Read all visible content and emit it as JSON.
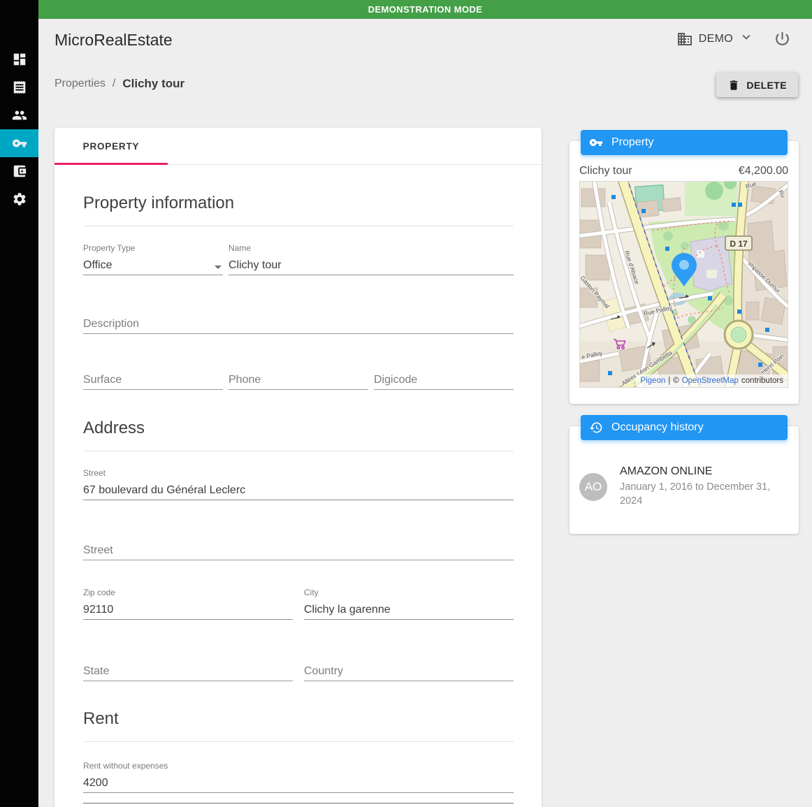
{
  "banner": {
    "text": "DEMONSTRATION MODE"
  },
  "header": {
    "app_title": "MicroRealEstate",
    "org_name": "DEMO"
  },
  "breadcrumb": {
    "parent": "Properties",
    "separator": "/",
    "current": "Clichy tour"
  },
  "actions": {
    "delete_label": "DELETE"
  },
  "sidebar": {
    "selected_index": 3,
    "items": [
      {
        "icon": "dashboard-icon"
      },
      {
        "icon": "rents-icon"
      },
      {
        "icon": "tenants-icon"
      },
      {
        "icon": "properties-key-icon"
      },
      {
        "icon": "accounting-icon"
      },
      {
        "icon": "settings-icon"
      }
    ]
  },
  "tabs": [
    {
      "label": "PROPERTY"
    }
  ],
  "form": {
    "property_information": {
      "title": "Property information",
      "property_type": {
        "label": "Property Type",
        "value": "Office"
      },
      "name": {
        "label": "Name",
        "value": "Clichy tour"
      },
      "description": {
        "label": "Description",
        "value": ""
      },
      "surface": {
        "label": "Surface",
        "value": ""
      },
      "phone": {
        "label": "Phone",
        "value": ""
      },
      "digicode": {
        "label": "Digicode",
        "value": ""
      }
    },
    "address": {
      "title": "Address",
      "street1": {
        "label": "Street",
        "value": "67 boulevard du Général Leclerc"
      },
      "street2": {
        "label": "Street",
        "value": ""
      },
      "zip": {
        "label": "Zip code",
        "value": "92110"
      },
      "city": {
        "label": "City",
        "value": "Clichy la garenne"
      },
      "state": {
        "label": "State",
        "value": ""
      },
      "country": {
        "label": "Country",
        "value": ""
      }
    },
    "rent": {
      "title": "Rent",
      "rent_without_expenses": {
        "label": "Rent without expenses",
        "value": "4200"
      }
    }
  },
  "property_card": {
    "header": "Property",
    "name": "Clichy tour",
    "rent": "€4,200.00",
    "map": {
      "road_badge": "D 17",
      "street_labels": [
        "Rue d'Alsace",
        "Rue Palloy",
        "Allées Léon Gambetta",
        "Gaston Paymal",
        "Impasse Dumur",
        "Henri Poin",
        "e Palloy",
        "Rue",
        "Ru"
      ],
      "attribution": {
        "library": "Pigeon",
        "separator": "|",
        "copyright": "©",
        "source": "OpenStreetMap",
        "suffix": "contributors"
      }
    }
  },
  "occupancy_card": {
    "header": "Occupancy history",
    "items": [
      {
        "avatar": "AO",
        "tenant": "AMAZON ONLINE",
        "period": "January 1, 2016 to December 31, 2024"
      }
    ]
  },
  "colors": {
    "banner_green": "#43a047",
    "accent_blue": "#2196f3",
    "tab_indicator_pink": "#e91e63",
    "sidebar_selected_cyan": "#00a7c4"
  }
}
